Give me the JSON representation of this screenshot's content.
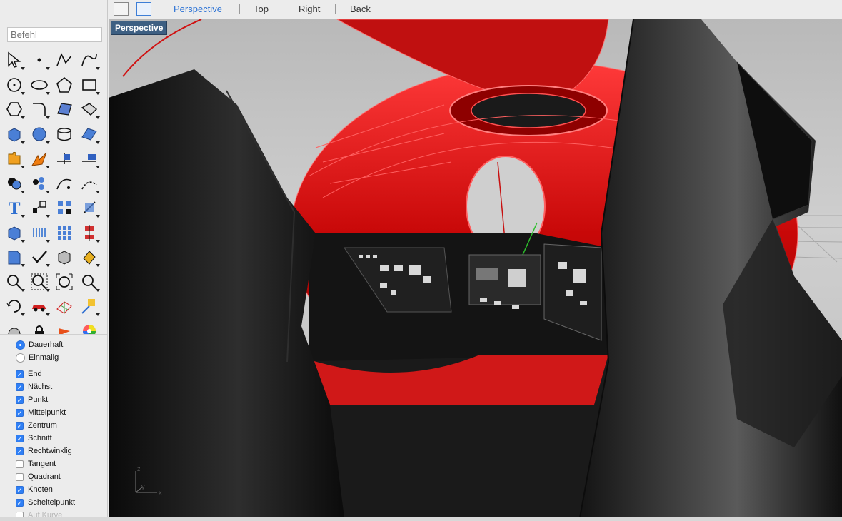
{
  "command": {
    "placeholder": "Befehl"
  },
  "toolbar": {
    "tools": [
      "select-arrow",
      "point",
      "polyline",
      "curve",
      "circle",
      "ellipse",
      "polygon",
      "rectangle",
      "hexagon",
      "fillet",
      "surface",
      "patch",
      "box",
      "sphere",
      "cylinder",
      "mesh",
      "puzzle-piece",
      "explode",
      "trim",
      "split",
      "boolean",
      "group",
      "curve-edit",
      "extend",
      "text",
      "scale",
      "array",
      "gumball",
      "solid-edit",
      "distribute",
      "grid-array",
      "align",
      "layer",
      "check",
      "shade",
      "paint",
      "zoom",
      "zoom-window",
      "zoom-extents",
      "zoom-selected",
      "rotate-view",
      "car",
      "grid-snap",
      "dimension",
      "sphere-small",
      "lock",
      "render",
      "color-wheel"
    ]
  },
  "osnap": {
    "modes": [
      {
        "label": "Dauerhaft",
        "selected": true
      },
      {
        "label": "Einmalig",
        "selected": false
      }
    ],
    "items": [
      {
        "label": "End",
        "checked": true
      },
      {
        "label": "Nächst",
        "checked": true
      },
      {
        "label": "Punkt",
        "checked": true
      },
      {
        "label": "Mittelpunkt",
        "checked": true
      },
      {
        "label": "Zentrum",
        "checked": true
      },
      {
        "label": "Schnitt",
        "checked": true
      },
      {
        "label": "Rechtwinklig",
        "checked": true
      },
      {
        "label": "Tangent",
        "checked": false
      },
      {
        "label": "Quadrant",
        "checked": false
      },
      {
        "label": "Knoten",
        "checked": true
      },
      {
        "label": "Scheitelpunkt",
        "checked": true
      },
      {
        "label": "Auf Kurve",
        "checked": false
      }
    ]
  },
  "tabs": [
    {
      "label": "Perspective",
      "active": true
    },
    {
      "label": "Top",
      "active": false
    },
    {
      "label": "Right",
      "active": false
    },
    {
      "label": "Back",
      "active": false
    }
  ],
  "viewport": {
    "label": "Perspective",
    "axes": {
      "x": "x",
      "y": "y",
      "z": "z"
    },
    "colors": {
      "accent": "#e01010",
      "model": "#161616",
      "ground": "#cfcfcf",
      "label_bg": "#3d5f82"
    }
  },
  "colors": {
    "accent": "#2b72d5"
  }
}
